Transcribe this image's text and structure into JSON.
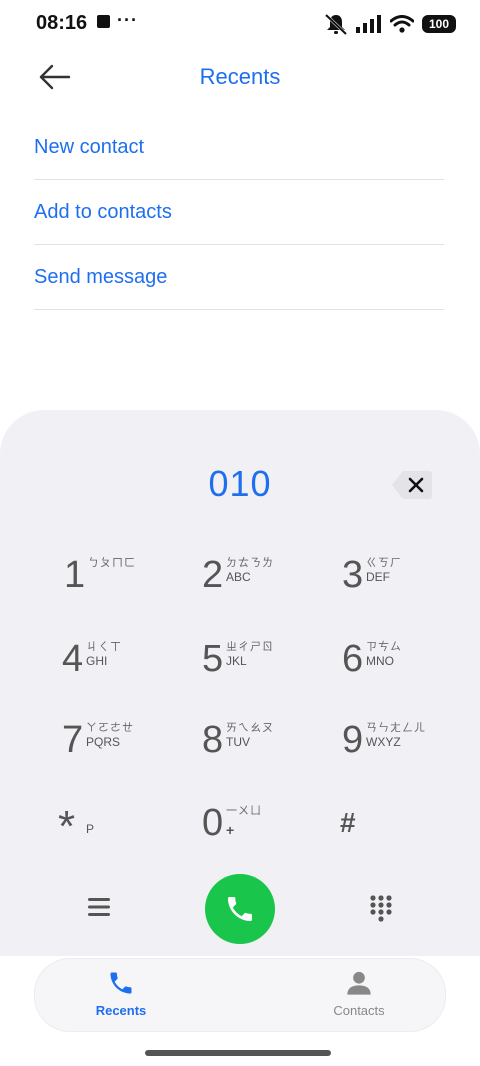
{
  "status_bar": {
    "time": "08:16",
    "dots": "···",
    "battery": "100"
  },
  "header": {
    "title": "Recents"
  },
  "actions": [
    {
      "label": "New contact"
    },
    {
      "label": "Add to contacts"
    },
    {
      "label": "Send message"
    }
  ],
  "dialer": {
    "number": "010",
    "keys": [
      {
        "digit": "1",
        "zhuyin": "ㄅㄆㄇㄈ",
        "letters": ""
      },
      {
        "digit": "2",
        "zhuyin": "ㄉㄊㄋㄌ",
        "letters": "ABC"
      },
      {
        "digit": "3",
        "zhuyin": "ㄍㄎㄏ",
        "letters": "DEF"
      },
      {
        "digit": "4",
        "zhuyin": "ㄐㄑㄒ",
        "letters": "GHI"
      },
      {
        "digit": "5",
        "zhuyin": "ㄓㄔㄕㄖ",
        "letters": "JKL"
      },
      {
        "digit": "6",
        "zhuyin": "ㄗㄘㄙ",
        "letters": "MNO"
      },
      {
        "digit": "7",
        "zhuyin": "ㄚㄛㄜㄝ",
        "letters": "PQRS"
      },
      {
        "digit": "8",
        "zhuyin": "ㄞㄟㄠㄡ",
        "letters": "TUV"
      },
      {
        "digit": "9",
        "zhuyin": "ㄢㄣㄤㄥㄦ",
        "letters": "WXYZ"
      },
      {
        "digit": "*",
        "sub": "P"
      },
      {
        "digit": "0",
        "zhuyin": "一ㄨㄩ",
        "sub": "+"
      },
      {
        "digit": "#"
      }
    ]
  },
  "nav": {
    "recents": "Recents",
    "contacts": "Contacts"
  },
  "colors": {
    "accent": "#1e6ff0",
    "call": "#19c64b",
    "dialer_bg": "#f1f1f5"
  }
}
